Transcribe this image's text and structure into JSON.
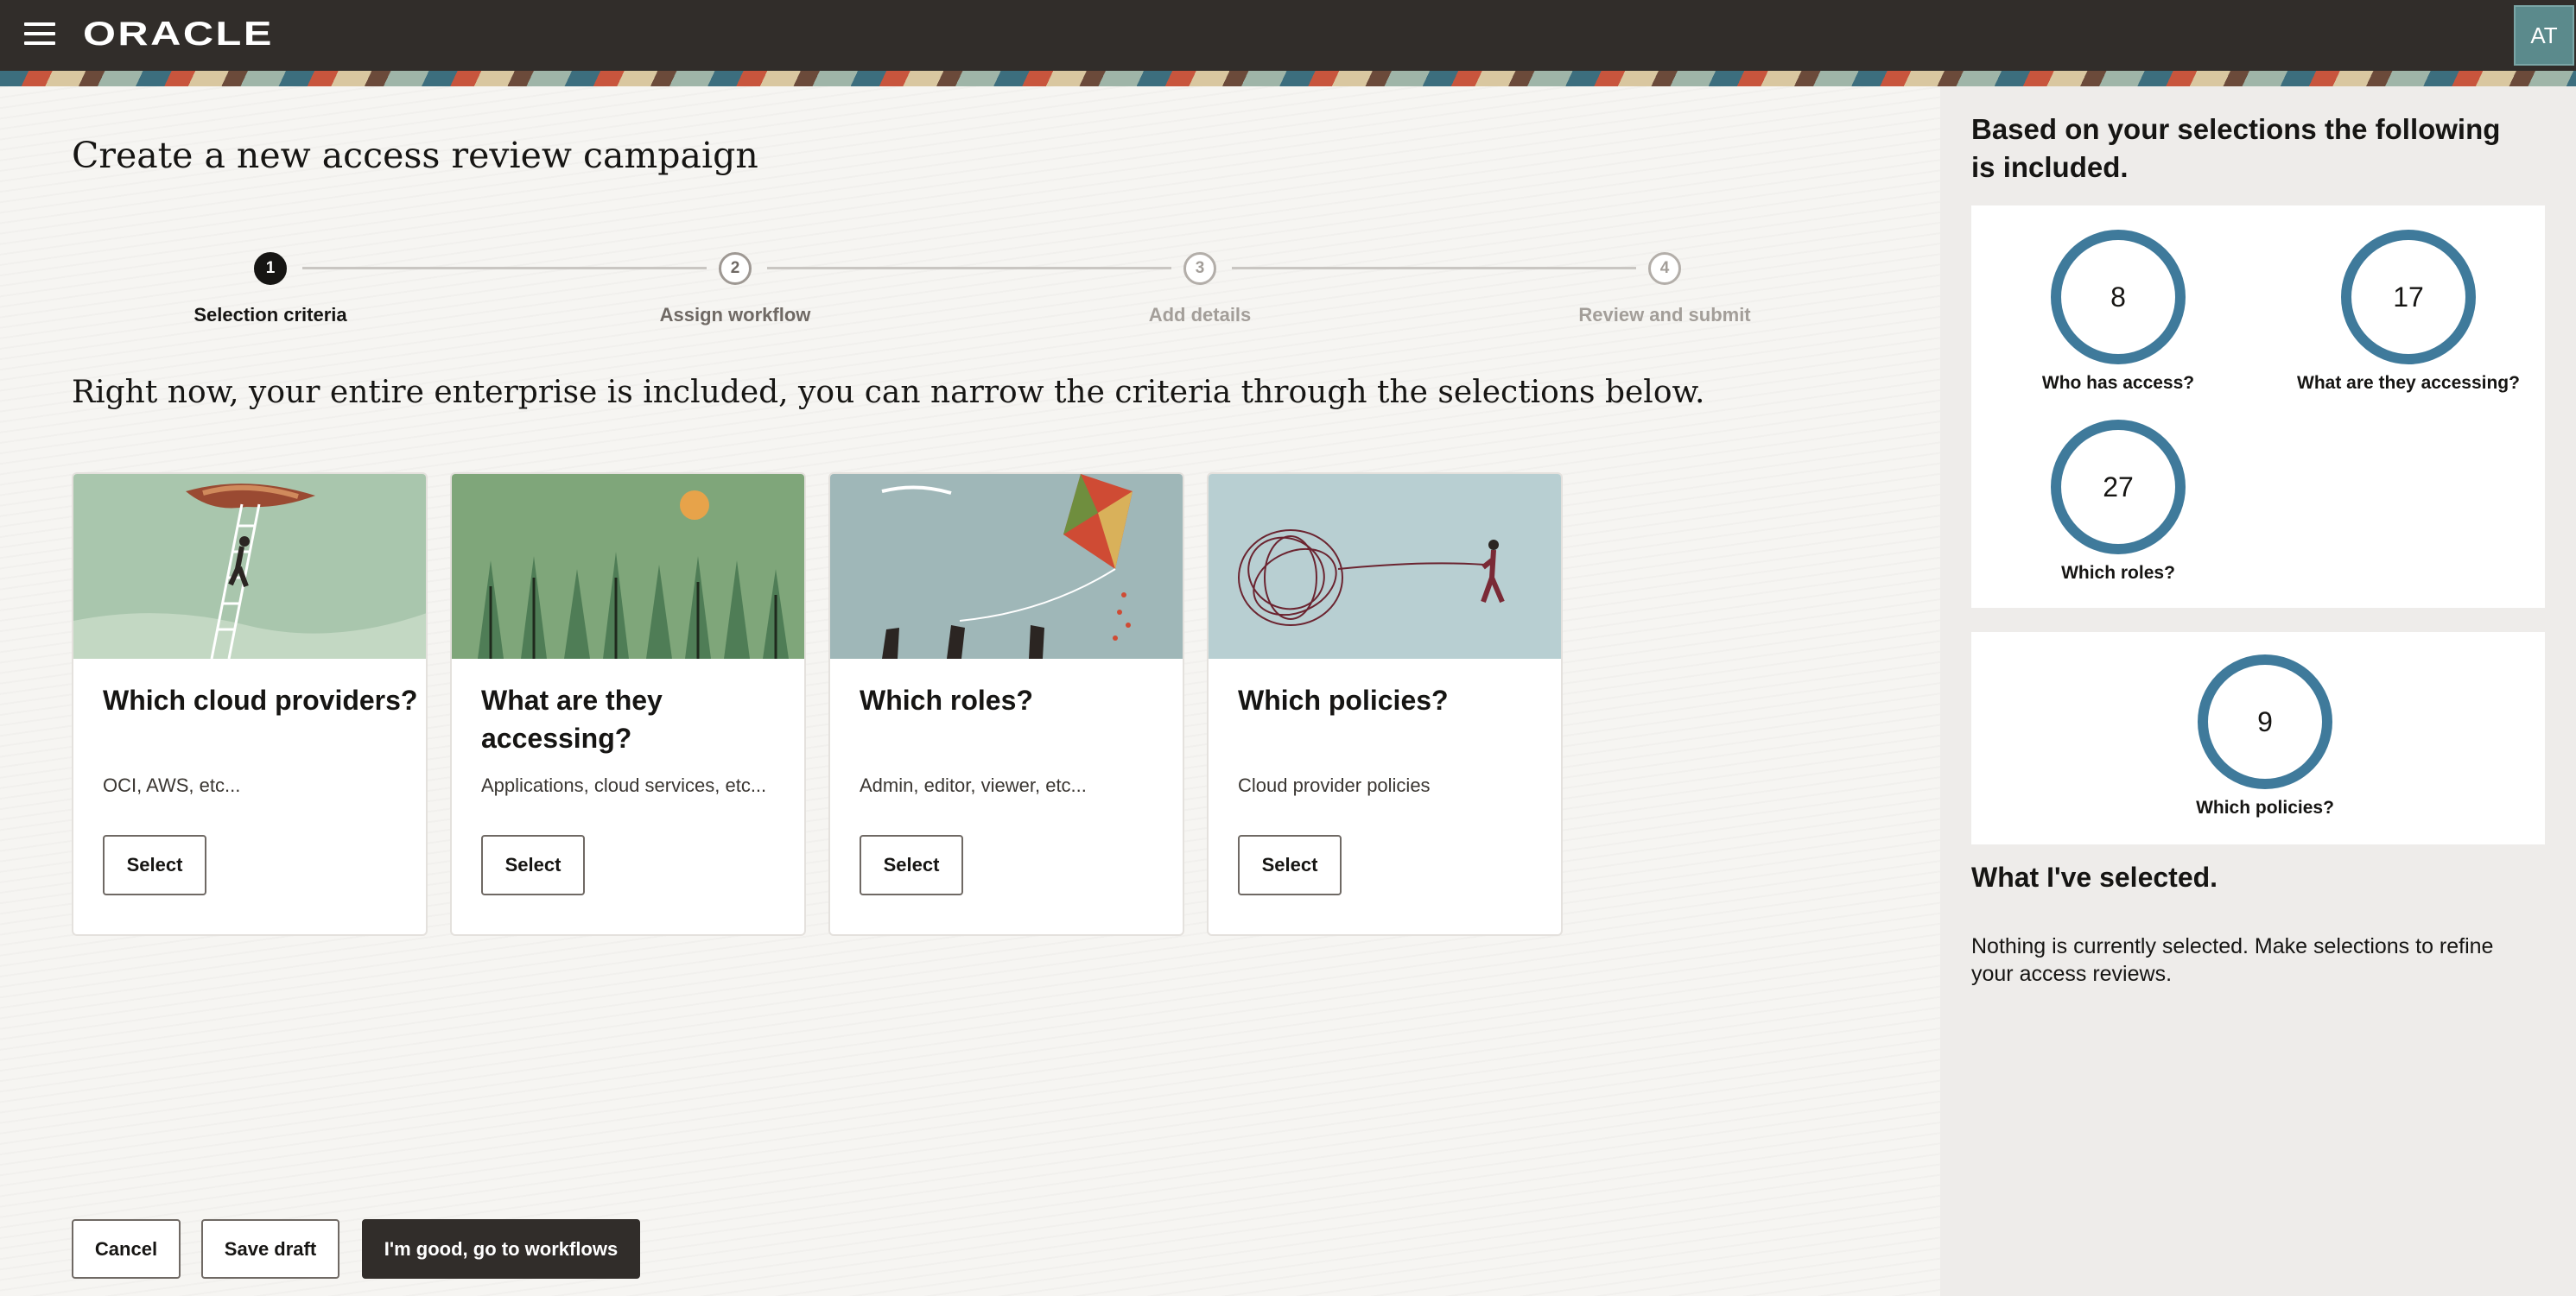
{
  "header": {
    "logo": "ORACLE",
    "avatar_initials": "AT"
  },
  "page": {
    "title": "Create a new access review campaign",
    "intro": "Right now, your entire enterprise is included, you can narrow the criteria through the selections below."
  },
  "stepper": {
    "steps": [
      {
        "number": "1",
        "label": "Selection criteria"
      },
      {
        "number": "2",
        "label": "Assign workflow"
      },
      {
        "number": "3",
        "label": "Add details"
      },
      {
        "number": "4",
        "label": "Review and submit"
      }
    ]
  },
  "cards": [
    {
      "title": "Which cloud providers?",
      "description": "OCI, AWS, etc...",
      "button": "Select"
    },
    {
      "title": "What are they accessing?",
      "description": "Applications, cloud services, etc...",
      "button": "Select"
    },
    {
      "title": "Which roles?",
      "description": "Admin, editor, viewer, etc...",
      "button": "Select"
    },
    {
      "title": "Which policies?",
      "description": "Cloud provider policies",
      "button": "Select"
    }
  ],
  "footer": {
    "cancel": "Cancel",
    "save_draft": "Save draft",
    "primary": "I'm good, go to workflows"
  },
  "summary": {
    "title": "Based on your selections the following is included.",
    "stats": [
      {
        "value": "8",
        "label": "Who has access?"
      },
      {
        "value": "17",
        "label": "What are they accessing?"
      },
      {
        "value": "27",
        "label": "Which roles?"
      },
      {
        "value": "9",
        "label": "Which policies?"
      }
    ],
    "ring_color": "#3f7a9b",
    "selected_title": "What I've selected.",
    "selected_text": "Nothing is currently selected. Make selections to refine your access reviews."
  }
}
